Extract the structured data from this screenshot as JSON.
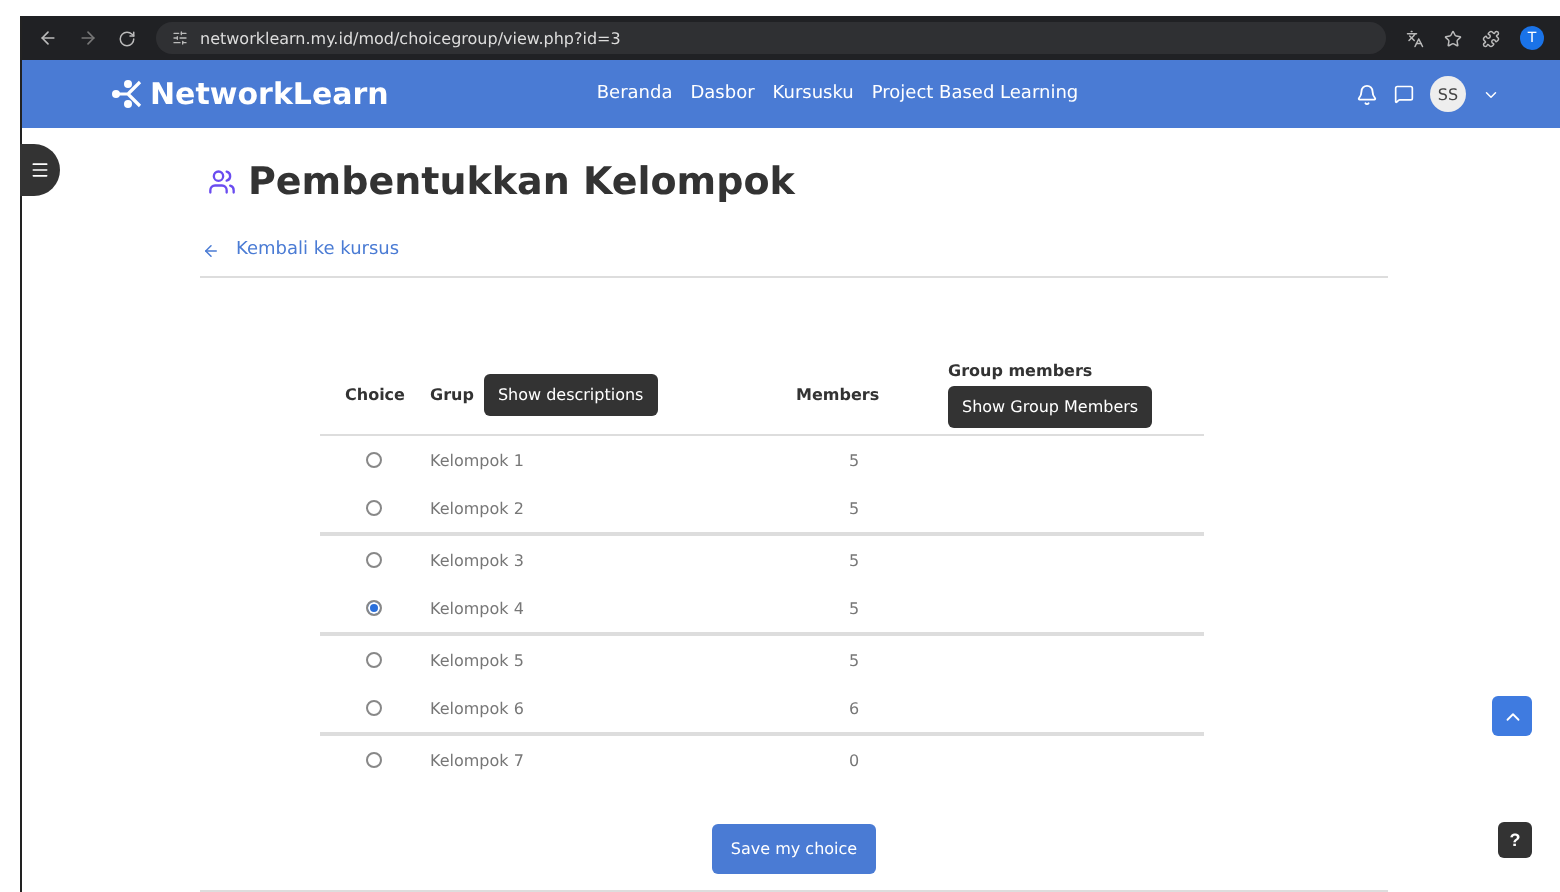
{
  "browser": {
    "url": "networklearn.my.id/mod/choicegroup/view.php?id=3",
    "profile": "T"
  },
  "navbar": {
    "brand": "NetworkLearn",
    "links": [
      "Beranda",
      "Dasbor",
      "Kursusku",
      "Project Based Learning"
    ],
    "avatar": "SS"
  },
  "page": {
    "title": "Pembentukkan Kelompok",
    "back_link": "Kembali ke kursus"
  },
  "table": {
    "columns": {
      "choice": "Choice",
      "group": "Grup",
      "group_button": "Show descriptions",
      "members": "Members",
      "group_members": "Group members",
      "group_members_button": "Show Group Members"
    },
    "rows": [
      {
        "name": "Kelompok 1",
        "members": "5",
        "selected": false
      },
      {
        "name": "Kelompok 2",
        "members": "5",
        "selected": false
      },
      {
        "name": "Kelompok 3",
        "members": "5",
        "selected": false
      },
      {
        "name": "Kelompok 4",
        "members": "5",
        "selected": true
      },
      {
        "name": "Kelompok 5",
        "members": "5",
        "selected": false
      },
      {
        "name": "Kelompok 6",
        "members": "6",
        "selected": false
      },
      {
        "name": "Kelompok 7",
        "members": "0",
        "selected": false
      }
    ]
  },
  "save_button": "Save my choice",
  "help_button": "?"
}
